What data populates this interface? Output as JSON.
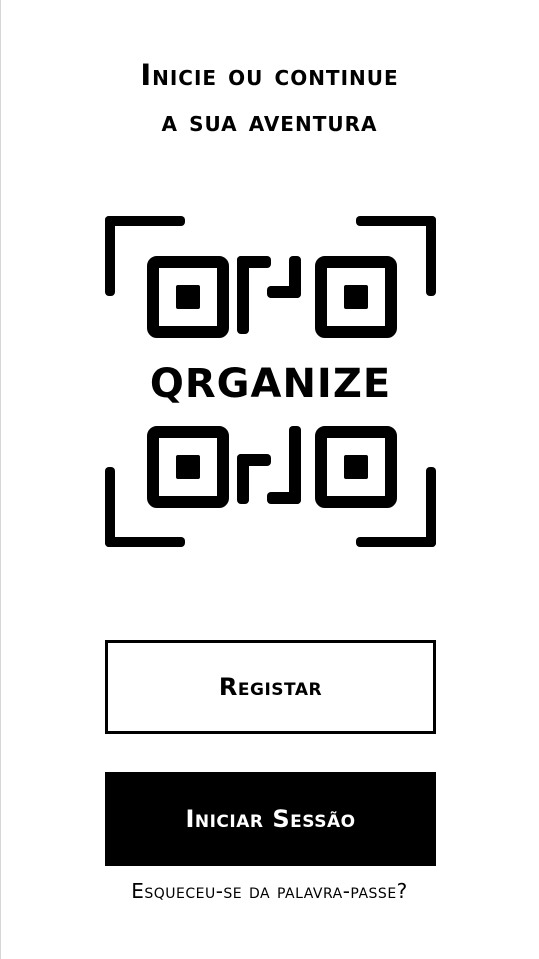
{
  "headline": {
    "line1": "Inicie ou continue",
    "line2": "a sua aventura"
  },
  "logo": {
    "wordmark": "QRGANIZE"
  },
  "buttons": {
    "register_label": "Registar",
    "login_label": "Iniciar Sessão"
  },
  "links": {
    "forgot_password": "Esqueceu-se da palavra-passe?"
  },
  "colors": {
    "background": "#ffffff",
    "foreground": "#000000"
  }
}
